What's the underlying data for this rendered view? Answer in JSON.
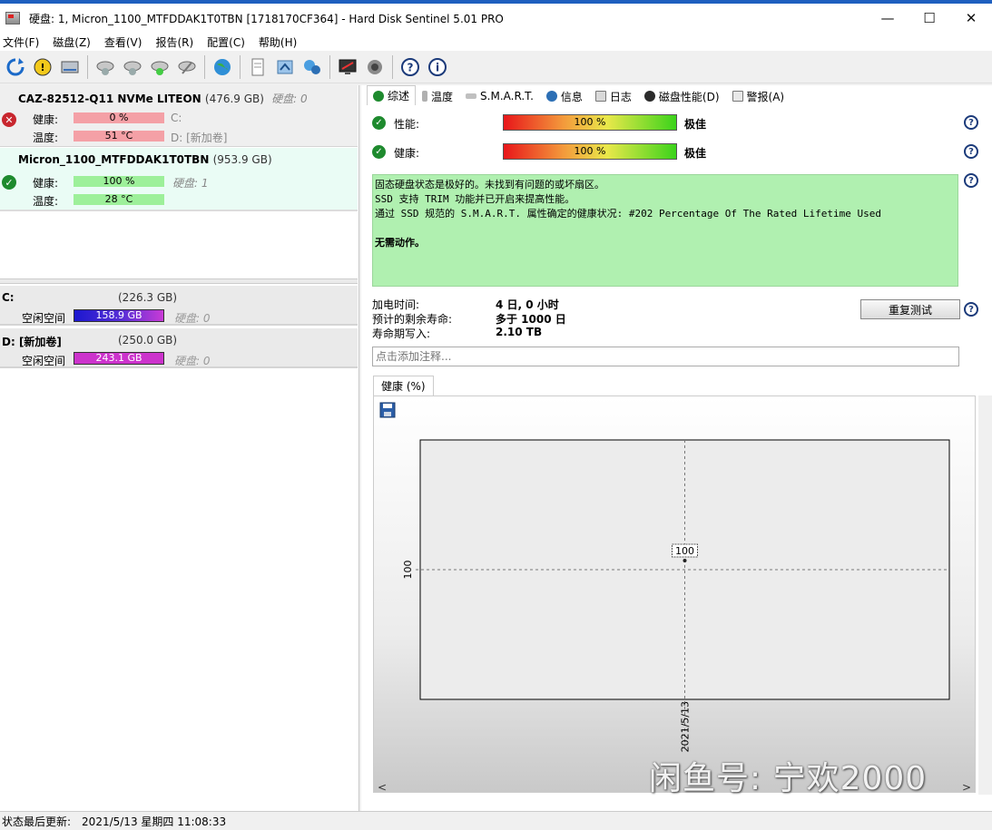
{
  "window": {
    "title": "硬盘:   1, Micron_1100_MTFDDAK1T0TBN [1718170CF364]  -  Hard Disk Sentinel 5.01 PRO",
    "minimize": "—",
    "maximize": "☐",
    "close": "✕"
  },
  "menu": [
    "文件(F)",
    "磁盘(Z)",
    "查看(V)",
    "报告(R)",
    "配置(C)",
    "帮助(H)"
  ],
  "toolbar": {
    "icons": [
      "refresh-icon",
      "alert-icon",
      "disk-icon",
      "disk-test-1-icon",
      "disk-test-2-icon",
      "disk-test-3-icon",
      "disk-test-4-icon",
      "globe-icon",
      "report-icon",
      "send-report-icon",
      "network-icon",
      "monitor-icon",
      "speaker-icon",
      "help-icon",
      "info-icon"
    ]
  },
  "disks": [
    {
      "name": "CAZ-82512-Q11 NVMe LITEON",
      "size": "(476.9 GB)",
      "hd_label": "硬盘: 0",
      "health_label": "健康:",
      "health_value": "0 %",
      "temp_label": "温度:",
      "temp_value": "51 °C",
      "partition_c": "C:",
      "partition_d": "D: [新加卷]",
      "status": "error"
    },
    {
      "name": "Micron_1100_MTFDDAK1T0TBN",
      "size": "(953.9 GB)",
      "hd_label": "硬盘: 1",
      "health_label": "健康:",
      "health_value": "100 %",
      "temp_label": "温度:",
      "temp_value": "28 °C",
      "status": "ok"
    }
  ],
  "volumes": [
    {
      "name": "C:",
      "size": "(226.3 GB)",
      "free_label": "空闲空间",
      "free_value": "158.9 GB",
      "hd_label": "硬盘: 0"
    },
    {
      "name": "D: [新加卷]",
      "size": "(250.0 GB)",
      "free_label": "空闲空间",
      "free_value": "243.1 GB",
      "hd_label": "硬盘: 0"
    }
  ],
  "tabs": [
    {
      "label": "综述",
      "active": true
    },
    {
      "label": "温度"
    },
    {
      "label": "S.M.A.R.T."
    },
    {
      "label": "信息"
    },
    {
      "label": "日志"
    },
    {
      "label": "磁盘性能(D)"
    },
    {
      "label": "警报(A)"
    }
  ],
  "summary": {
    "performance_label": "性能:",
    "performance_value": "100 %",
    "performance_word": "极佳",
    "performance_level": 100,
    "health_label": "健康:",
    "health_value": "100 %",
    "health_word": "极佳",
    "health_level": 100,
    "message_lines": [
      "固态硬盘状态是极好的。未找到有问题的或坏扇区。",
      "SSD 支持 TRIM 功能并已开启来提高性能。",
      "通过 SSD 规范的 S.M.A.R.T. 属性确定的健康状况:   #202 Percentage Of The Rated Lifetime Used"
    ],
    "action": "无需动作。",
    "power_on_label": "加电时间:",
    "power_on_value": "4 日, 0 小时",
    "remaining_life_label": "预计的剩余寿命:",
    "remaining_life_value": "多于 1000 日",
    "written_label": "寿命期写入:",
    "written_value": "2.10 TB",
    "retest_button": "重复测试",
    "note_placeholder": "点击添加注释..."
  },
  "chart_tab": "健康 (%)",
  "chart_data": {
    "type": "line",
    "x": [
      "2021/5/13"
    ],
    "series": [
      {
        "values": [
          100
        ]
      }
    ],
    "y_tick": "100",
    "data_label": "100",
    "grid": true
  },
  "watermark": "闲鱼号:  宁欢2000",
  "statusbar": {
    "label": "状态最后更新:",
    "value": "2021/5/13 星期四 11:08:33"
  }
}
